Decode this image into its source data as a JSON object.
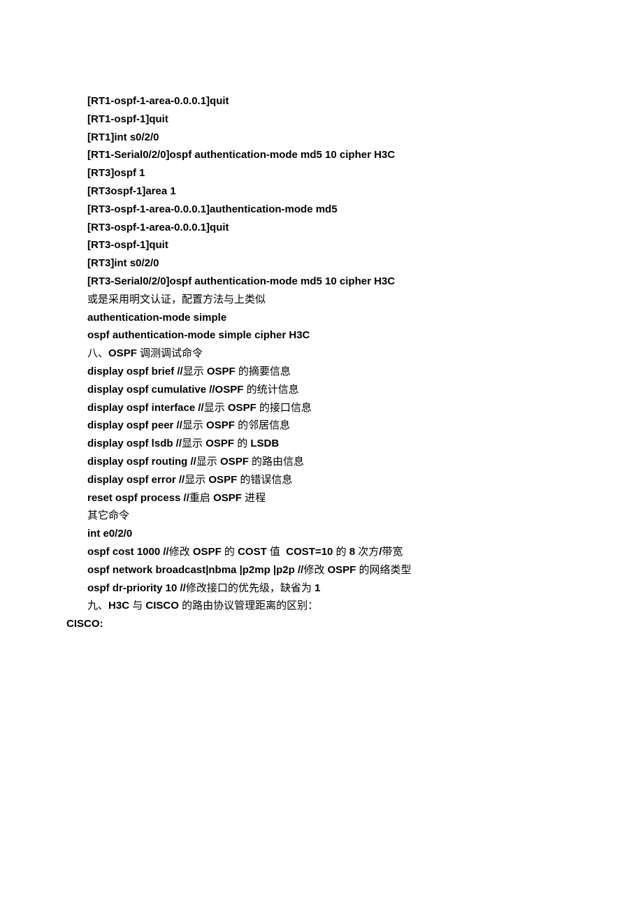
{
  "lines": [
    {
      "segments": [
        {
          "text": "[RT1-ospf-1-area-0.0.0.1]quit",
          "bold": true
        }
      ]
    },
    {
      "segments": [
        {
          "text": "[RT1-ospf-1]quit",
          "bold": true
        }
      ]
    },
    {
      "segments": [
        {
          "text": "[RT1]int s0/2/0",
          "bold": true
        }
      ]
    },
    {
      "segments": [
        {
          "text": "[RT1-Serial0/2/0]ospf authentication-mode md5 10 cipher H3C",
          "bold": true
        }
      ]
    },
    {
      "segments": [
        {
          "text": "[RT3]ospf 1",
          "bold": true
        }
      ]
    },
    {
      "segments": [
        {
          "text": "[RT3ospf-1]area 1",
          "bold": true
        }
      ]
    },
    {
      "segments": [
        {
          "text": "[RT3-ospf-1-area-0.0.0.1]authentication-mode md5",
          "bold": true
        }
      ]
    },
    {
      "segments": [
        {
          "text": "[RT3-ospf-1-area-0.0.0.1]quit",
          "bold": true
        }
      ]
    },
    {
      "segments": [
        {
          "text": "[RT3-ospf-1]quit",
          "bold": true
        }
      ]
    },
    {
      "segments": [
        {
          "text": "[RT3]int s0/2/0",
          "bold": true
        }
      ]
    },
    {
      "segments": [
        {
          "text": "[RT3-Serial0/2/0]ospf authentication-mode md5 10 cipher H3C",
          "bold": true
        }
      ]
    },
    {
      "segments": [
        {
          "text": "或是采用明文认证，配置方法与上类似",
          "bold": false
        }
      ]
    },
    {
      "segments": [
        {
          "text": "authentication-mode simple",
          "bold": true
        }
      ]
    },
    {
      "segments": [
        {
          "text": "ospf authentication-mode simple cipher H3C",
          "bold": true
        }
      ]
    },
    {
      "segments": [
        {
          "text": "八、",
          "bold": false
        },
        {
          "text": "OSPF ",
          "bold": true
        },
        {
          "text": "调测调试命令",
          "bold": false
        }
      ]
    },
    {
      "segments": [
        {
          "text": "display ospf brief //",
          "bold": true
        },
        {
          "text": "显示 ",
          "bold": false
        },
        {
          "text": "OSPF ",
          "bold": true
        },
        {
          "text": "的摘要信息",
          "bold": false
        }
      ]
    },
    {
      "segments": [
        {
          "text": "display ospf cumulative //OSPF ",
          "bold": true
        },
        {
          "text": "的统计信息",
          "bold": false
        }
      ]
    },
    {
      "segments": [
        {
          "text": "display ospf interface //",
          "bold": true
        },
        {
          "text": "显示 ",
          "bold": false
        },
        {
          "text": "OSPF ",
          "bold": true
        },
        {
          "text": "的接口信息",
          "bold": false
        }
      ]
    },
    {
      "segments": [
        {
          "text": "display ospf peer //",
          "bold": true
        },
        {
          "text": "显示 ",
          "bold": false
        },
        {
          "text": "OSPF ",
          "bold": true
        },
        {
          "text": "的邻居信息",
          "bold": false
        }
      ]
    },
    {
      "segments": [
        {
          "text": "display ospf lsdb //",
          "bold": true
        },
        {
          "text": "显示 ",
          "bold": false
        },
        {
          "text": "OSPF ",
          "bold": true
        },
        {
          "text": "的 ",
          "bold": false
        },
        {
          "text": "LSDB",
          "bold": true
        }
      ]
    },
    {
      "segments": [
        {
          "text": "display ospf routing //",
          "bold": true
        },
        {
          "text": "显示 ",
          "bold": false
        },
        {
          "text": "OSPF ",
          "bold": true
        },
        {
          "text": "的路由信息",
          "bold": false
        }
      ]
    },
    {
      "segments": [
        {
          "text": "display ospf error //",
          "bold": true
        },
        {
          "text": "显示 ",
          "bold": false
        },
        {
          "text": "OSPF ",
          "bold": true
        },
        {
          "text": "的错误信息",
          "bold": false
        }
      ]
    },
    {
      "segments": [
        {
          "text": "reset ospf process //",
          "bold": true
        },
        {
          "text": "重启 ",
          "bold": false
        },
        {
          "text": "OSPF ",
          "bold": true
        },
        {
          "text": "进程",
          "bold": false
        }
      ]
    },
    {
      "segments": [
        {
          "text": "其它命令",
          "bold": false
        }
      ]
    },
    {
      "segments": [
        {
          "text": "int e0/2/0",
          "bold": true
        }
      ]
    },
    {
      "segments": [
        {
          "text": "ospf cost 1000 //",
          "bold": true
        },
        {
          "text": "修改 ",
          "bold": false
        },
        {
          "text": "OSPF ",
          "bold": true
        },
        {
          "text": "的 ",
          "bold": false
        },
        {
          "text": "COST ",
          "bold": true
        },
        {
          "text": "值  ",
          "bold": false
        },
        {
          "text": "COST=10 ",
          "bold": true
        },
        {
          "text": "的 ",
          "bold": false
        },
        {
          "text": "8 ",
          "bold": true
        },
        {
          "text": "次方",
          "bold": false
        },
        {
          "text": "/",
          "bold": true
        },
        {
          "text": "带宽",
          "bold": false
        }
      ]
    },
    {
      "segments": [
        {
          "text": "ospf network broadcast|nbma |p2mp |p2p //",
          "bold": true
        },
        {
          "text": "修改 ",
          "bold": false
        },
        {
          "text": "OSPF ",
          "bold": true
        },
        {
          "text": "的网络类型",
          "bold": false
        }
      ]
    },
    {
      "segments": [
        {
          "text": "ospf dr-priority 10 //",
          "bold": true
        },
        {
          "text": "修改接口的优先级，缺省为 ",
          "bold": false
        },
        {
          "text": "1",
          "bold": true
        }
      ]
    },
    {
      "segments": [
        {
          "text": "九、",
          "bold": false
        },
        {
          "text": "H3C ",
          "bold": true
        },
        {
          "text": "与 ",
          "bold": false
        },
        {
          "text": "CISCO ",
          "bold": true
        },
        {
          "text": "的路由协议管理距离的区别：",
          "bold": false
        }
      ]
    },
    {
      "cls": "cisco",
      "segments": [
        {
          "text": "CISCO:",
          "bold": true
        }
      ]
    }
  ]
}
